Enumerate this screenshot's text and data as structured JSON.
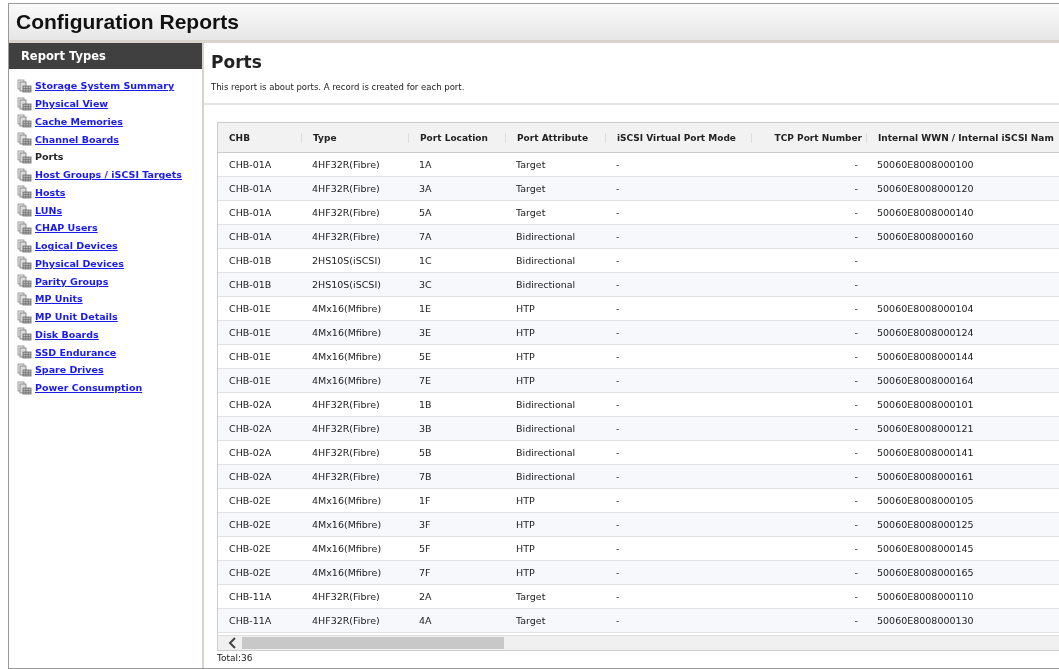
{
  "window": {
    "title": "Configuration Reports"
  },
  "sidebar": {
    "title": "Report Types",
    "items": [
      {
        "label": "Storage System Summary",
        "selected": false
      },
      {
        "label": "Physical View",
        "selected": false
      },
      {
        "label": "Cache Memories",
        "selected": false
      },
      {
        "label": "Channel Boards",
        "selected": false
      },
      {
        "label": "Ports",
        "selected": true
      },
      {
        "label": "Host Groups / iSCSI Targets",
        "selected": false
      },
      {
        "label": "Hosts",
        "selected": false
      },
      {
        "label": "LUNs",
        "selected": false
      },
      {
        "label": "CHAP Users",
        "selected": false
      },
      {
        "label": "Logical Devices",
        "selected": false
      },
      {
        "label": "Physical Devices",
        "selected": false
      },
      {
        "label": "Parity Groups",
        "selected": false
      },
      {
        "label": "MP Units",
        "selected": false
      },
      {
        "label": "MP Unit Details",
        "selected": false
      },
      {
        "label": "Disk Boards",
        "selected": false
      },
      {
        "label": "SSD Endurance",
        "selected": false
      },
      {
        "label": "Spare Drives",
        "selected": false
      },
      {
        "label": "Power Consumption",
        "selected": false
      }
    ]
  },
  "report": {
    "title": "Ports",
    "description": "This report is about ports. A record is created for each port.",
    "table": {
      "columns": [
        "CHB",
        "Type",
        "Port Location",
        "Port Attribute",
        "iSCSI Virtual Port Mode",
        "TCP Port Number",
        "Internal WWN / Internal iSCSI Nam"
      ],
      "rows": [
        [
          "CHB-01A",
          "4HF32R(Fibre)",
          "1A",
          "Target",
          "-",
          "-",
          "50060E8008000100"
        ],
        [
          "CHB-01A",
          "4HF32R(Fibre)",
          "3A",
          "Target",
          "-",
          "-",
          "50060E8008000120"
        ],
        [
          "CHB-01A",
          "4HF32R(Fibre)",
          "5A",
          "Target",
          "-",
          "-",
          "50060E8008000140"
        ],
        [
          "CHB-01A",
          "4HF32R(Fibre)",
          "7A",
          "Bidirectional",
          "-",
          "-",
          "50060E8008000160"
        ],
        [
          "CHB-01B",
          "2HS10S(iSCSI)",
          "1C",
          "Bidirectional",
          "-",
          "-",
          ""
        ],
        [
          "CHB-01B",
          "2HS10S(iSCSI)",
          "3C",
          "Bidirectional",
          "-",
          "-",
          ""
        ],
        [
          "CHB-01E",
          "4Mx16(Mfibre)",
          "1E",
          "HTP",
          "-",
          "-",
          "50060E8008000104"
        ],
        [
          "CHB-01E",
          "4Mx16(Mfibre)",
          "3E",
          "HTP",
          "-",
          "-",
          "50060E8008000124"
        ],
        [
          "CHB-01E",
          "4Mx16(Mfibre)",
          "5E",
          "HTP",
          "-",
          "-",
          "50060E8008000144"
        ],
        [
          "CHB-01E",
          "4Mx16(Mfibre)",
          "7E",
          "HTP",
          "-",
          "-",
          "50060E8008000164"
        ],
        [
          "CHB-02A",
          "4HF32R(Fibre)",
          "1B",
          "Bidirectional",
          "-",
          "-",
          "50060E8008000101"
        ],
        [
          "CHB-02A",
          "4HF32R(Fibre)",
          "3B",
          "Bidirectional",
          "-",
          "-",
          "50060E8008000121"
        ],
        [
          "CHB-02A",
          "4HF32R(Fibre)",
          "5B",
          "Bidirectional",
          "-",
          "-",
          "50060E8008000141"
        ],
        [
          "CHB-02A",
          "4HF32R(Fibre)",
          "7B",
          "Bidirectional",
          "-",
          "-",
          "50060E8008000161"
        ],
        [
          "CHB-02E",
          "4Mx16(Mfibre)",
          "1F",
          "HTP",
          "-",
          "-",
          "50060E8008000105"
        ],
        [
          "CHB-02E",
          "4Mx16(Mfibre)",
          "3F",
          "HTP",
          "-",
          "-",
          "50060E8008000125"
        ],
        [
          "CHB-02E",
          "4Mx16(Mfibre)",
          "5F",
          "HTP",
          "-",
          "-",
          "50060E8008000145"
        ],
        [
          "CHB-02E",
          "4Mx16(Mfibre)",
          "7F",
          "HTP",
          "-",
          "-",
          "50060E8008000165"
        ],
        [
          "CHB-11A",
          "4HF32R(Fibre)",
          "2A",
          "Target",
          "-",
          "-",
          "50060E8008000110"
        ],
        [
          "CHB-11A",
          "4HF32R(Fibre)",
          "4A",
          "Target",
          "-",
          "-",
          "50060E8008000130"
        ]
      ]
    },
    "total": "Total:36"
  }
}
